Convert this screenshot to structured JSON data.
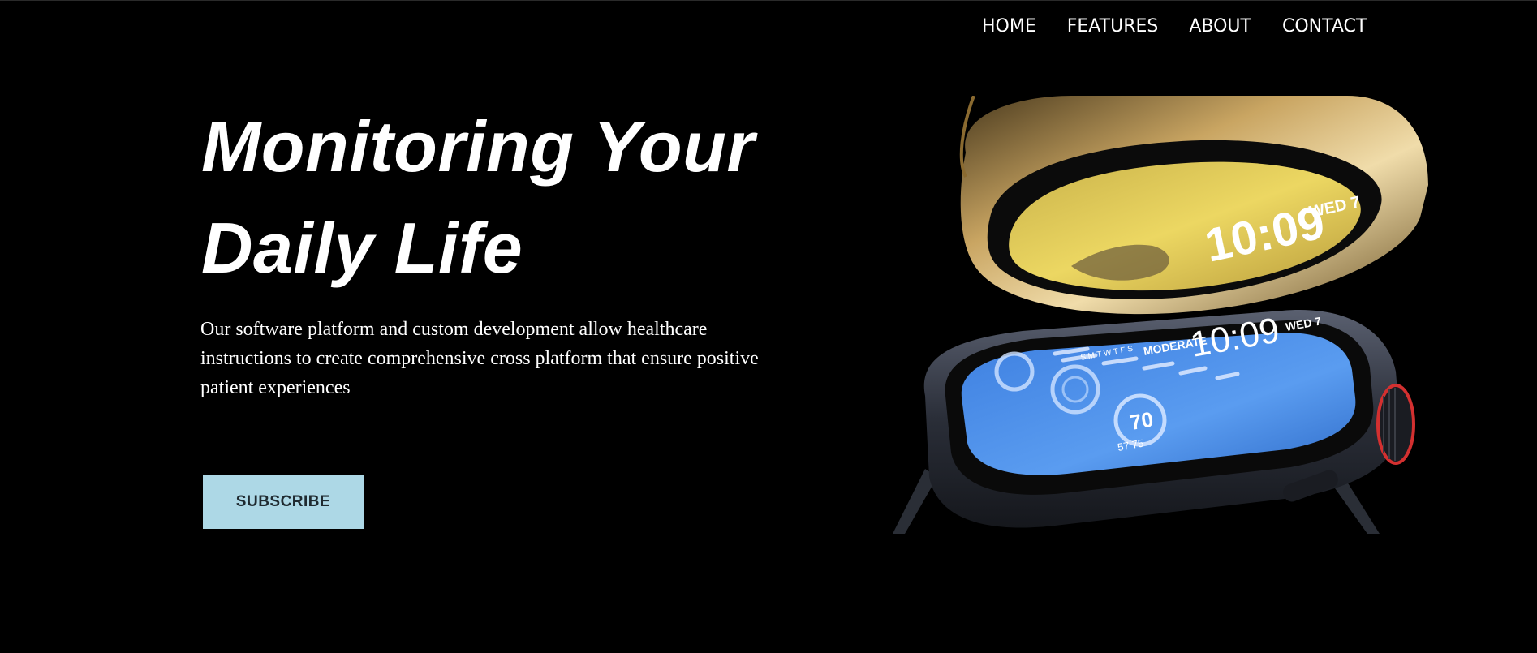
{
  "nav": {
    "items": [
      {
        "label": "HOME"
      },
      {
        "label": "FEATURES"
      },
      {
        "label": "ABOUT"
      },
      {
        "label": "CONTACT"
      }
    ]
  },
  "hero": {
    "title_line1": "Monitoring Your",
    "title_line2": "Daily Life",
    "description": "Our software platform and custom development allow healthcare instructions to create comprehensive cross platform that ensure positive patient experiences",
    "cta_label": "SUBSCRIBE"
  },
  "watch_image": {
    "top_face_time": "10:09",
    "top_face_day": "WED 7",
    "bottom_face_time": "10:09",
    "bottom_face_day": "WED 7",
    "bottom_face_tag": "MODERATE",
    "bottom_face_temp": "70",
    "bottom_face_range": "57 75",
    "bottom_face_week": "S M T W T F S"
  },
  "colors": {
    "background": "#000000",
    "text": "#ffffff",
    "cta_background": "#add8e6",
    "cta_text": "#1f2a30",
    "watch_screen_top": "#e8d34e",
    "watch_screen_bottom": "#4a8fe7",
    "watch_gold": "#b08a4a",
    "watch_crown_ring": "#d33030"
  }
}
